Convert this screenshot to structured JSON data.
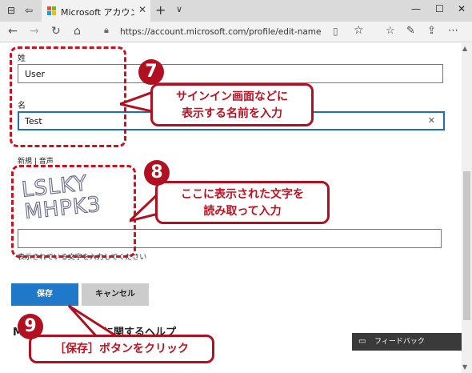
{
  "browser": {
    "tab_title": "Microsoft アカウント | 自分",
    "url": "https://account.microsoft.com/profile/edit-name",
    "icons": {
      "back": "arrow-left",
      "forward": "arrow-right",
      "refresh": "refresh",
      "home": "home",
      "lock": "lock",
      "reading_view": "book",
      "favorites": "star",
      "hub": "favorites-list",
      "notes": "pen",
      "share": "share",
      "more": "ellipsis"
    }
  },
  "form": {
    "last_name_label": "姓",
    "last_name_value": "User",
    "first_name_label": "名",
    "first_name_value": "Test",
    "captcha_label": "新規 | 音声",
    "captcha_text": "LSLKY MHPK3",
    "captcha_input_value": "",
    "captcha_help": "表示されている文字を入力してください",
    "save_label": "保存",
    "cancel_label": "キャンセル",
    "help_heading": "M",
    "help_heading_tail": "に関するヘルプ",
    "feedback_label": "フィードバック"
  },
  "annotations": {
    "step7_number": "7",
    "step7_line1": "サインイン画面などに",
    "step7_line2": "表示する名前を入力",
    "step8_number": "8",
    "step8_line1": "ここに表示された文字を",
    "step8_line2": "読み取って入力",
    "step9_number": "9",
    "step9_text": "［保存］ボタンをクリック"
  },
  "colors": {
    "accent": "#1f78c8",
    "annotation_red": "#b01020",
    "focus_border": "#1a6fbf"
  }
}
